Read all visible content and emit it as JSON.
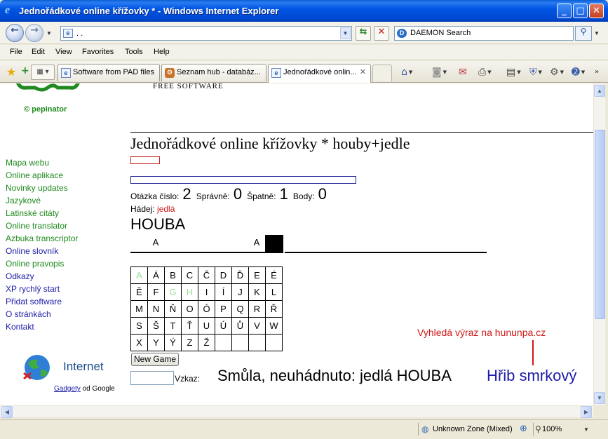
{
  "window": {
    "title": "Jednořádkové online křížovky * - Windows Internet Explorer",
    "minimize": "_",
    "maximize": "□",
    "close": "✕"
  },
  "addressbar": {
    "url": ". .",
    "search_provider": "DAEMON Search"
  },
  "menu": [
    "File",
    "Edit",
    "View",
    "Favorites",
    "Tools",
    "Help"
  ],
  "tabs": [
    {
      "label": "Software from PAD files",
      "icon": "ie-page-icon"
    },
    {
      "label": "Seznam hub - databáz...",
      "icon": "bear-icon"
    },
    {
      "label": "Jednořádkové onlin...",
      "icon": "ie-page-icon",
      "active": true
    }
  ],
  "header": {
    "copyright": "© pepinator",
    "free_software": "FREE SOFTWARE"
  },
  "sidebar": {
    "items": [
      {
        "label": "Mapa webu",
        "color": "#1f8a1f"
      },
      {
        "label": "Online aplikace",
        "color": "#1f8a1f"
      },
      {
        "label": "Novinky updates",
        "color": "#1f8a1f"
      },
      {
        "label": "Jazykové",
        "color": "#1f8a1f"
      },
      {
        "label": "Latinské citáty",
        "color": "#1f8a1f"
      },
      {
        "label": "Online translator",
        "color": "#1f8a1f"
      },
      {
        "label": "Azbuka transcriptor",
        "color": "#1f8a1f"
      },
      {
        "label": "Online slovník",
        "color": "#1c1ca8"
      },
      {
        "label": "Online pravopis",
        "color": "#1f8a1f"
      },
      {
        "label": "Odkazy",
        "color": "#1c1ca8"
      },
      {
        "label": "XP rychlý start",
        "color": "#1c1ca8"
      },
      {
        "label": "Přidat software",
        "color": "#1c1ca8"
      },
      {
        "label": "O stránkách",
        "color": "#1c1ca8"
      },
      {
        "label": "Kontakt",
        "color": "#1c1ca8"
      }
    ]
  },
  "game": {
    "title": "Jednořádkové online křížovky * houby+jedle",
    "question_label": "Otázka číslo:",
    "question_number": "2",
    "correct_label": "Správně:",
    "correct": "0",
    "wrong_label": "Špatně:",
    "wrong": "1",
    "points_label": "Body:",
    "points": "0",
    "guess_label": "Hádej:",
    "guess_word": "jedlá",
    "answer_word": "HOUBA",
    "slots": [
      "",
      "A",
      "",
      "",
      "",
      "",
      "",
      "A",
      "#",
      "",
      "",
      "",
      "",
      "",
      "",
      "",
      "",
      "",
      "",
      "",
      ""
    ],
    "letters": [
      [
        "A",
        "Á",
        "B",
        "C",
        "Č",
        "D",
        "Ď",
        "E",
        "É"
      ],
      [
        "Ě",
        "F",
        "G",
        "H",
        "I",
        "Í",
        "J",
        "K",
        "L"
      ],
      [
        "M",
        "N",
        "Ň",
        "O",
        "Ó",
        "P",
        "Q",
        "R",
        "Ř"
      ],
      [
        "S",
        "Š",
        "T",
        "Ť",
        "U",
        "Ú",
        "Ů",
        "V",
        "W"
      ],
      [
        "X",
        "Y",
        "Ý",
        "Z",
        "Ž",
        "",
        "",
        "",
        ""
      ]
    ],
    "used_letters": [
      "A",
      "G",
      "H"
    ],
    "new_game_label": "New Game",
    "message_label": "Vzkaz:",
    "result": "Smůla, neuhádnuto: jedlá HOUBA",
    "result_link": "Hřib smrkový",
    "search_hint": "Vyhledá výraz na hununpa.cz"
  },
  "gadget": {
    "title": "Internet",
    "link": "Gadgety",
    "suffix": " od Google"
  },
  "status": {
    "zone": "Unknown Zone (Mixed)",
    "zoom": "100%"
  }
}
